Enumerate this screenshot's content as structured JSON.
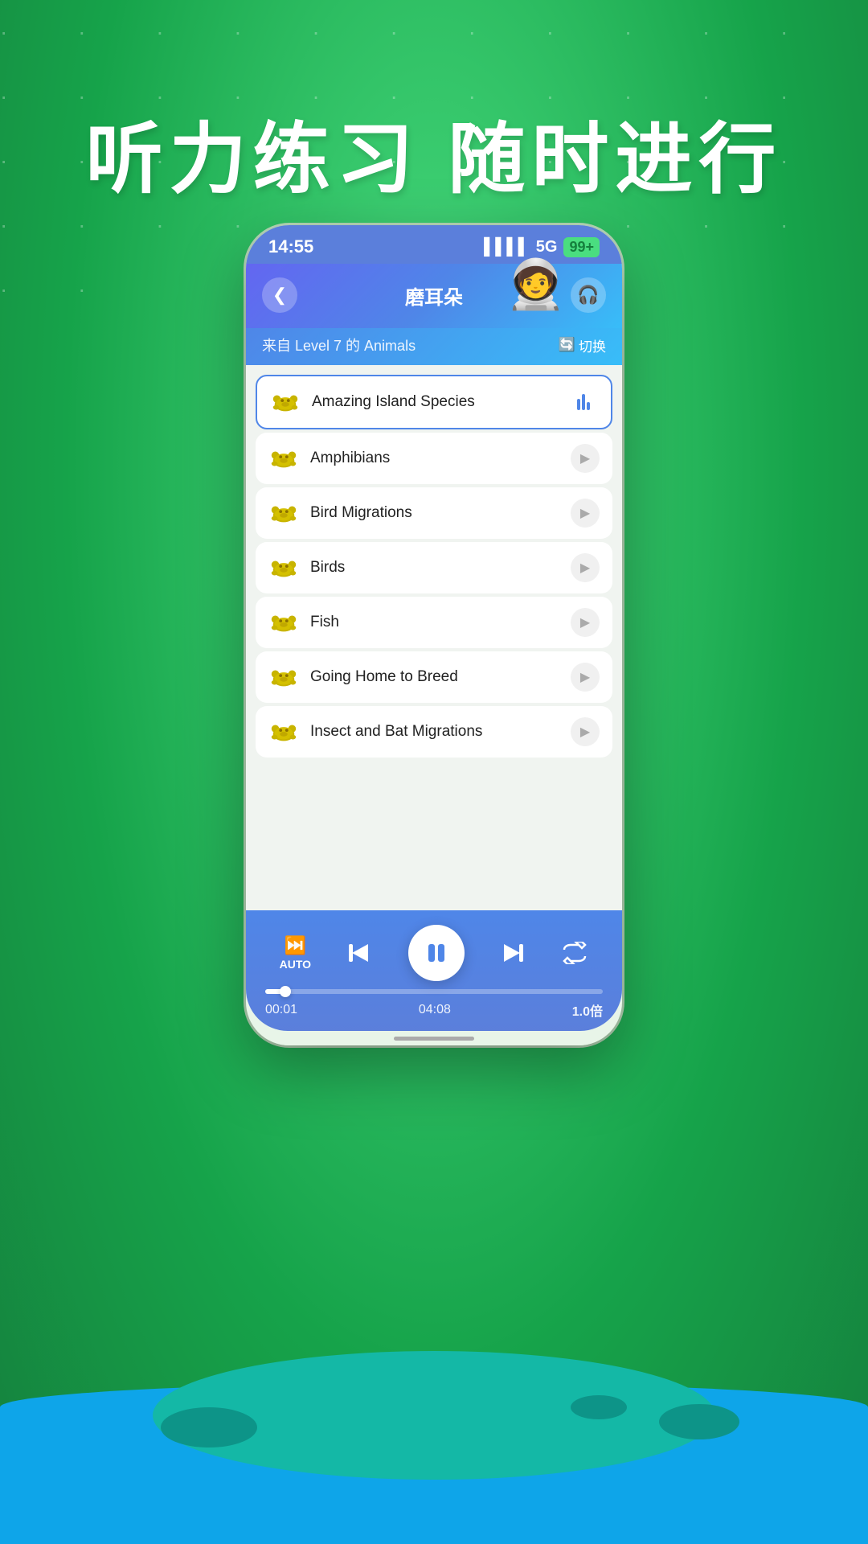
{
  "background": {
    "color": "#22c55e"
  },
  "header_title": "听力练习  随时进行",
  "status_bar": {
    "time": "14:55",
    "signal": "5G",
    "battery": "99+"
  },
  "app_header": {
    "back_label": "‹",
    "title": "磨耳朵",
    "earphone_icon": "🎧",
    "subtitle": "来自 Level 7 的 Animals",
    "switch_label": "切换"
  },
  "tracks": [
    {
      "name": "Amazing Island Species",
      "active": true
    },
    {
      "name": "Amphibians",
      "active": false
    },
    {
      "name": "Bird Migrations",
      "active": false
    },
    {
      "name": "Birds",
      "active": false
    },
    {
      "name": "Fish",
      "active": false
    },
    {
      "name": "Going Home to Breed",
      "active": false
    },
    {
      "name": "Insect and Bat Migrations",
      "active": false
    }
  ],
  "player": {
    "auto_label": "AUTO",
    "current_time": "00:01",
    "total_time": "04:08",
    "speed": "1.0倍",
    "progress_percent": 6
  }
}
